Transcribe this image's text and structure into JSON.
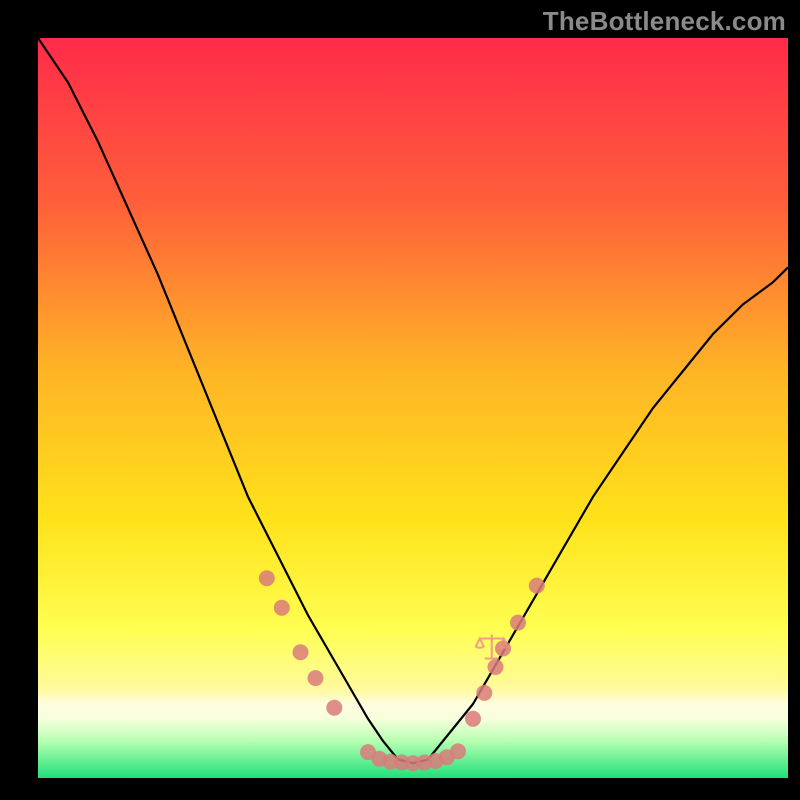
{
  "watermark": "TheBottleneck.com",
  "colors": {
    "background": "#000000",
    "gradient_top": "#ff2b4a",
    "gradient_mid_upper": "#ff7a33",
    "gradient_mid": "#ffd633",
    "gradient_mid_lower": "#ffff66",
    "gradient_band": "#fffccf",
    "gradient_bottom": "#1fe07a",
    "curve": "#000000",
    "dots": "#d97b7b"
  },
  "chart_data": {
    "type": "line",
    "title": "",
    "xlabel": "",
    "ylabel": "",
    "x_range": [
      0,
      100
    ],
    "y_range": [
      0,
      100
    ],
    "series": [
      {
        "name": "bottleneck-curve",
        "x": [
          0,
          4,
          8,
          12,
          16,
          20,
          24,
          28,
          32,
          36,
          40,
          44,
          46,
          48,
          50,
          52,
          54,
          58,
          62,
          66,
          70,
          74,
          78,
          82,
          86,
          90,
          94,
          98,
          100
        ],
        "y": [
          100,
          94,
          86,
          77,
          68,
          58,
          48,
          38,
          30,
          22,
          15,
          8,
          5,
          2.5,
          2,
          2.5,
          5,
          10,
          17,
          24,
          31,
          38,
          44,
          50,
          55,
          60,
          64,
          67,
          69
        ]
      }
    ],
    "markers": {
      "name": "highlighted-points",
      "points": [
        {
          "x": 30.5,
          "y": 27
        },
        {
          "x": 32.5,
          "y": 23
        },
        {
          "x": 35,
          "y": 17
        },
        {
          "x": 37,
          "y": 13.5
        },
        {
          "x": 39.5,
          "y": 9.5
        },
        {
          "x": 44,
          "y": 3.5
        },
        {
          "x": 45.5,
          "y": 2.6
        },
        {
          "x": 47,
          "y": 2.2
        },
        {
          "x": 48.5,
          "y": 2.1
        },
        {
          "x": 50,
          "y": 2
        },
        {
          "x": 51.5,
          "y": 2.1
        },
        {
          "x": 53,
          "y": 2.3
        },
        {
          "x": 54.5,
          "y": 2.8
        },
        {
          "x": 56,
          "y": 3.6
        },
        {
          "x": 58,
          "y": 8
        },
        {
          "x": 59.5,
          "y": 11.5
        },
        {
          "x": 61,
          "y": 15
        },
        {
          "x": 62,
          "y": 17.5
        },
        {
          "x": 64,
          "y": 21
        },
        {
          "x": 66.5,
          "y": 26
        }
      ]
    },
    "mini_balance_icon": {
      "x": 60.5,
      "y": 17.5
    },
    "legend": [],
    "grid": false
  }
}
